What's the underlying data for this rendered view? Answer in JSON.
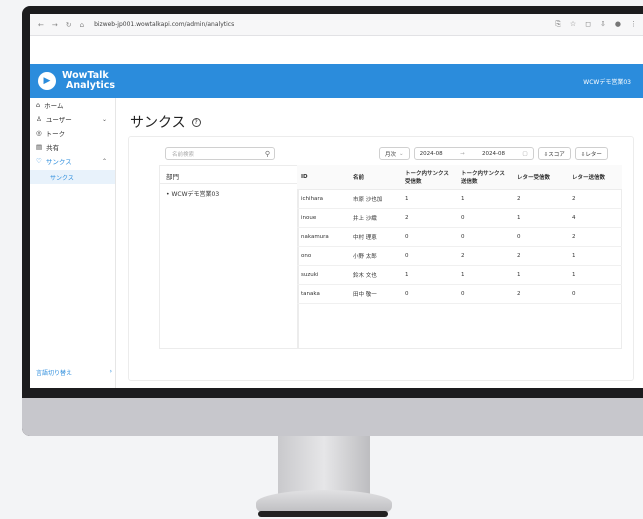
{
  "browser": {
    "url": "bizweb-jp001.wowtalkapi.com/admin/analytics"
  },
  "header": {
    "logo_line1": "WowTalk",
    "logo_line2": "Analytics",
    "user": "WCWデモ営業03"
  },
  "sidebar": {
    "items": [
      {
        "label": "ホーム",
        "icon": "⌂"
      },
      {
        "label": "ユーザー",
        "icon": "♙",
        "chev": "⌄"
      },
      {
        "label": "トーク",
        "icon": "◎"
      },
      {
        "label": "共有",
        "icon": "▤"
      },
      {
        "label": "サンクス",
        "icon": "♡",
        "chev": "⌃"
      }
    ],
    "sub_item": "サンクス",
    "footer_label": "言語切り替え",
    "footer_arrow": "›"
  },
  "page": {
    "title": "サンクス",
    "help": "?"
  },
  "filters": {
    "search_placeholder": "名前検索",
    "period": "月次",
    "period_arrow": "⌄",
    "date_from": "2024-08",
    "date_sep": "→",
    "date_to": "2024-08",
    "export_thanks": "⇩スコア",
    "export_letter": "⇩レター"
  },
  "departments": {
    "header": "部門",
    "items": [
      "WCWデモ営業03"
    ]
  },
  "table": {
    "columns": [
      "ID",
      "名前",
      "トーク内サンクス受信数",
      "トーク内サンクス送信数",
      "レター受信数",
      "レター送信数"
    ],
    "rows": [
      [
        "ichihara",
        "市原 沙也加",
        "1",
        "1",
        "2",
        "2"
      ],
      [
        "inoue",
        "井上 沙織",
        "2",
        "0",
        "1",
        "4"
      ],
      [
        "nakamura",
        "中村 理恵",
        "0",
        "0",
        "0",
        "2"
      ],
      [
        "ono",
        "小野 太郎",
        "0",
        "2",
        "2",
        "1"
      ],
      [
        "suzuki",
        "鈴木 文也",
        "1",
        "1",
        "1",
        "1"
      ],
      [
        "tanaka",
        "田中 敬一",
        "0",
        "0",
        "2",
        "0"
      ]
    ]
  }
}
